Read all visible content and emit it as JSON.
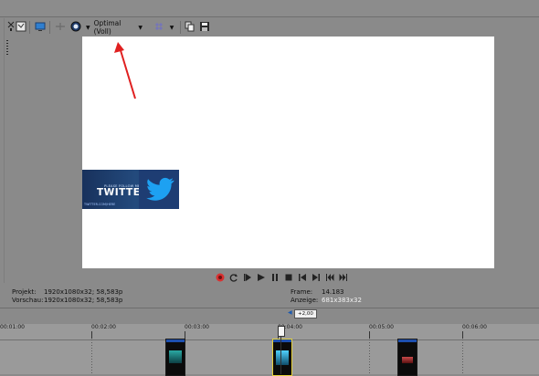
{
  "toolbar": {
    "quality_label": "Optimal (Voll)",
    "icons": [
      "dock-pin-icon",
      "project-properties-icon",
      "preview-device-icon",
      "split-screen-icon",
      "overlay-icon",
      "dropdown-arrow-icon",
      "quality-dropdown-icon",
      "grid-icon",
      "grid-dropdown-icon",
      "copy-snapshot-icon",
      "save-snapshot-icon"
    ]
  },
  "overlay": {
    "small_text": "PLEASE FOLLOW ME ON",
    "big_text": "TWITTER!",
    "handle_text": "TWITTER.COM/HERE"
  },
  "transport": {
    "buttons": [
      "record-icon",
      "loop-icon",
      "play-from-start-icon",
      "play-icon",
      "pause-icon",
      "stop-icon",
      "go-to-start-icon",
      "go-to-end-icon",
      "prev-frame-icon",
      "next-frame-icon"
    ]
  },
  "info": {
    "project_label": "Projekt:",
    "project_value": "1920x1080x32; 58,583p",
    "preview_label": "Vorschau:",
    "preview_value": "1920x1080x32; 58,583p",
    "frame_label": "Frame:",
    "frame_value": "14.183",
    "display_label": "Anzeige:",
    "display_value": "681x383x32"
  },
  "rate": {
    "value": "+2,00"
  },
  "timeline": {
    "ticks": [
      "00:01:00",
      "00:02:00",
      "00:03:00",
      "00:04:00",
      "00:05:00",
      "00:06:00"
    ]
  },
  "colors": {
    "panel": "#8a8a8a",
    "preview_bg": "#ffffff",
    "annotation_arrow": "#e02020",
    "twitter_blue": "#1da1f2",
    "record_red": "#d83030"
  }
}
